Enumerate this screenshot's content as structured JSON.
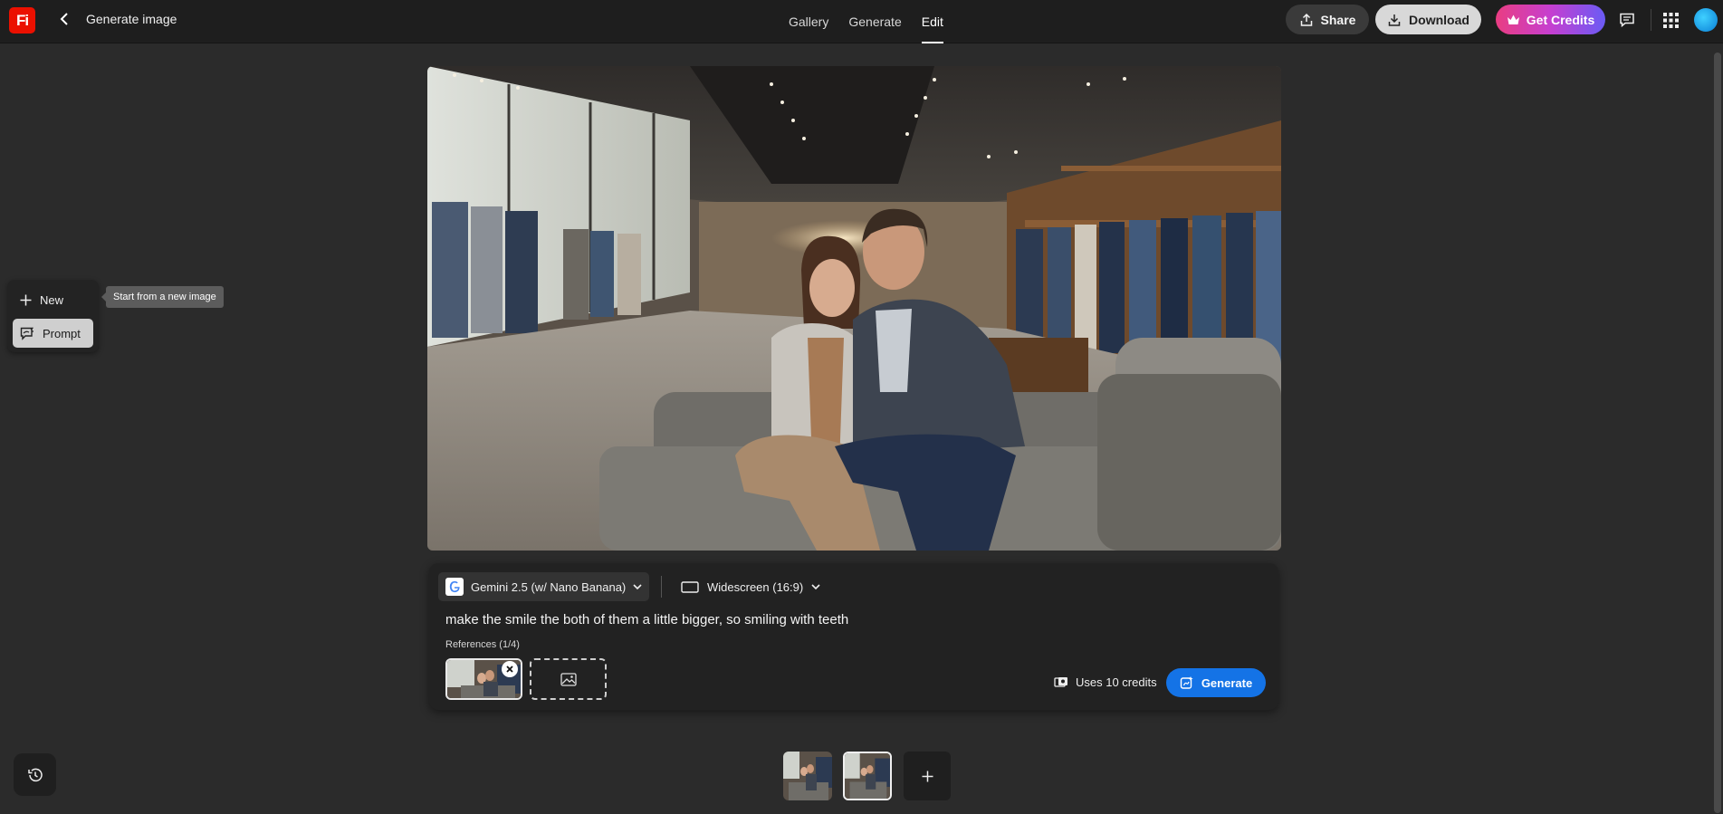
{
  "header": {
    "logo_text": "Fi",
    "title": "Generate image",
    "tabs": [
      {
        "label": "Gallery",
        "active": false
      },
      {
        "label": "Generate",
        "active": false
      },
      {
        "label": "Edit",
        "active": true
      }
    ],
    "share_label": "Share",
    "download_label": "Download",
    "credits_label": "Get Credits",
    "icons": [
      "back-chevron-icon",
      "share-icon",
      "download-icon",
      "crown-icon",
      "feedback-icon",
      "apps-grid-icon"
    ]
  },
  "tool_panel": {
    "items": [
      {
        "label": "New",
        "icon": "plus-icon",
        "selected": false
      },
      {
        "label": "Prompt",
        "icon": "prompt-icon",
        "selected": true
      }
    ],
    "tooltip": "Start from a new image"
  },
  "prompt_panel": {
    "model": "Gemini 2.5 (w/ Nano Banana)",
    "aspect": "Widescreen (16:9)",
    "prompt": "make the smile the both of them a little bigger, so smiling with teeth",
    "references_label": "References (1/4)",
    "credits_text": "Uses 10 credits",
    "generate_label": "Generate"
  },
  "colors": {
    "accent_blue": "#1473e6",
    "logo_red": "#eb1000",
    "credits_gradient": [
      "#e93d82",
      "#6a5bf5"
    ]
  }
}
